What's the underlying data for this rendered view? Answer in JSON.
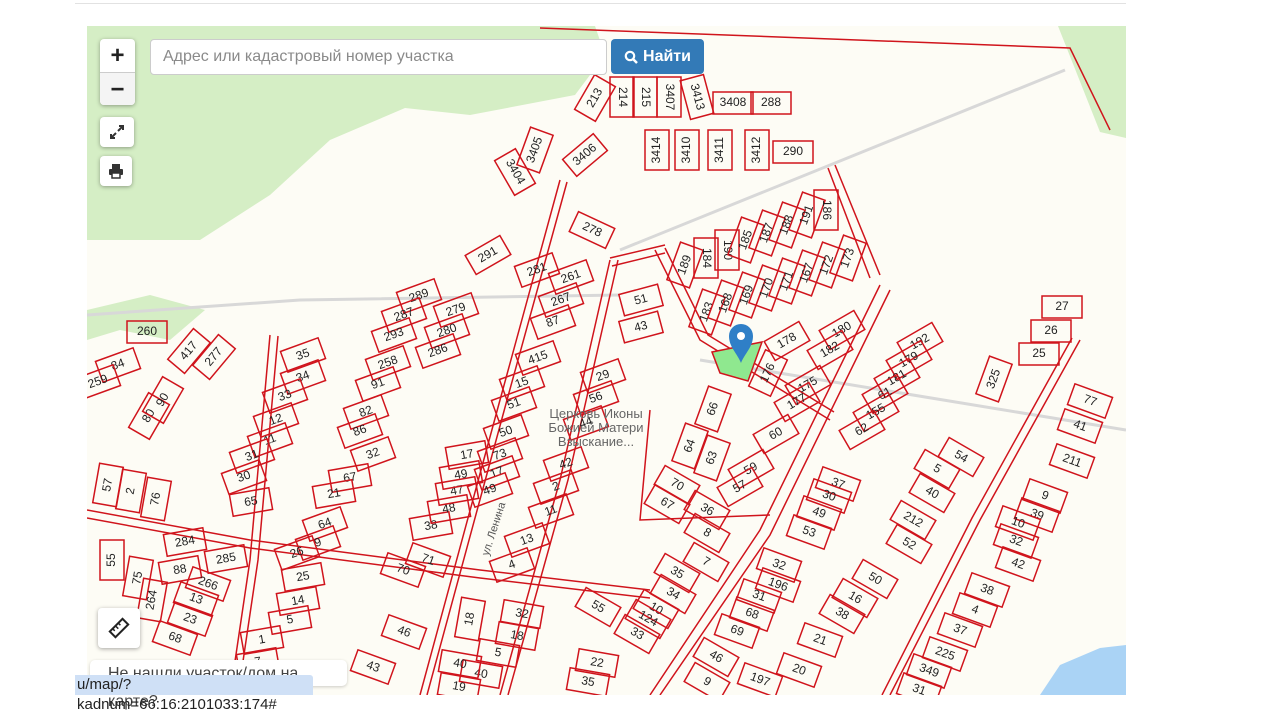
{
  "search": {
    "placeholder": "Адрес или кадастровый номер участка",
    "value": "",
    "button_label": "Найти",
    "button_icon": "search-icon"
  },
  "controls": {
    "zoom_in": "+",
    "zoom_out": "−",
    "fullscreen_icon": "expand-icon",
    "print_icon": "printer-icon",
    "ruler_icon": "ruler-icon"
  },
  "help_text": "Не нашли участок/дом на карте?",
  "status_url": "u/map/?kadnum=66:16:2101033:174#",
  "map": {
    "poi_label": "Церковь Иконы Божией Матери Взыскание...",
    "street_label": "ул. Ленина",
    "selected_parcel_color": "#8fe88f",
    "parcel_border_color": "#d0141c",
    "forest_color": "#d5eec5",
    "water_color": "#aad3f5",
    "marker_color": "#2f7fc7",
    "parcels": [
      "213",
      "214",
      "215",
      "3407",
      "3413",
      "3408",
      "288",
      "3414",
      "3410",
      "3411",
      "3412",
      "290",
      "3405",
      "3404",
      "3406",
      "278",
      "291",
      "281",
      "261",
      "267",
      "87",
      "51",
      "43",
      "189",
      "184",
      "190",
      "185",
      "187",
      "188",
      "191",
      "186",
      "183",
      "168",
      "169",
      "170",
      "171",
      "167",
      "172",
      "173",
      "178",
      "180",
      "182",
      "176",
      "175",
      "177",
      "192",
      "179",
      "181",
      "61",
      "155",
      "62",
      "66",
      "60",
      "64",
      "63",
      "59",
      "57",
      "415",
      "15",
      "51",
      "50",
      "73",
      "17",
      "49",
      "29",
      "56",
      "44",
      "42",
      "2",
      "11",
      "13",
      "4",
      "289",
      "279",
      "287",
      "280",
      "293",
      "286",
      "258",
      "91",
      "82",
      "86",
      "32",
      "260",
      "84",
      "259",
      "417",
      "277",
      "80",
      "90",
      "35",
      "34",
      "33",
      "12",
      "11",
      "31",
      "30",
      "65",
      "67",
      "21",
      "38",
      "48",
      "47",
      "49",
      "17",
      "64",
      "9",
      "26",
      "25",
      "14",
      "5",
      "1",
      "7",
      "284",
      "285",
      "88",
      "266",
      "13",
      "23",
      "68",
      "55",
      "75",
      "264",
      "57",
      "2",
      "76",
      "71",
      "70",
      "46",
      "43",
      "18",
      "32",
      "18",
      "5",
      "40",
      "40",
      "19",
      "22",
      "35",
      "55",
      "36",
      "70",
      "67",
      "8",
      "7",
      "35",
      "34",
      "10",
      "124",
      "33",
      "46",
      "9",
      "37",
      "30",
      "49",
      "53",
      "32",
      "196",
      "31",
      "68",
      "69",
      "20",
      "197",
      "21",
      "38",
      "16",
      "50",
      "52",
      "212",
      "40",
      "5",
      "54",
      "325",
      "27",
      "26",
      "25",
      "77",
      "41",
      "211",
      "9",
      "39",
      "10",
      "32",
      "42",
      "38",
      "4",
      "37",
      "225",
      "349",
      "31"
    ]
  }
}
